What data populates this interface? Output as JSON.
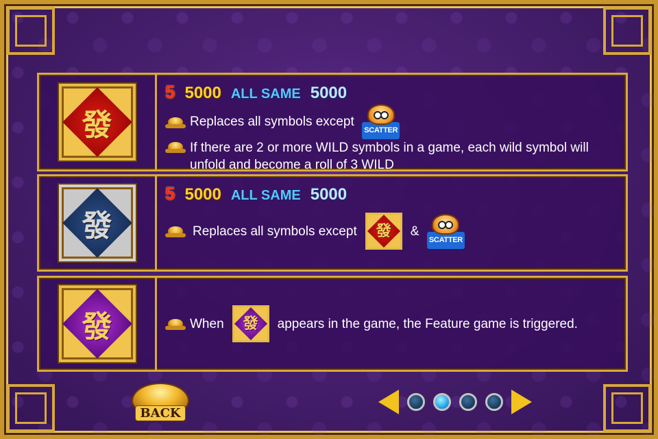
{
  "panels": [
    {
      "symbol_glyph": "發",
      "symbol_style": "red",
      "payout": {
        "count": "5",
        "value": "5000",
        "all_same_label": "ALL SAME",
        "all_same_value": "5000"
      },
      "lines": [
        {
          "text": "Replaces all symbols except",
          "icon": "scatter-lion"
        },
        {
          "text": "If there are 2 or more WILD symbols in a game, each wild symbol will unfold and become a roll of 3 WILD"
        }
      ]
    },
    {
      "symbol_glyph": "發",
      "symbol_style": "blue",
      "payout": {
        "count": "5",
        "value": "5000",
        "all_same_label": "ALL SAME",
        "all_same_value": "5000"
      },
      "lines": [
        {
          "text": "Replaces all symbols except",
          "amp": "&"
        }
      ]
    },
    {
      "symbol_glyph": "發",
      "symbol_style": "purple",
      "lines": [
        {
          "before": "When",
          "after": "appears in the game, the Feature game is triggered."
        }
      ]
    }
  ],
  "scatter_label": "SCATTER",
  "footer": {
    "back_label": "BACK",
    "pages": 4,
    "active_page": 2
  },
  "colors": {
    "gold": "#d8aa3e",
    "background": "#48206f",
    "payout_count": "#ff2a1a",
    "payout_value": "#ffd21f",
    "all_same": "#56c8ff"
  }
}
